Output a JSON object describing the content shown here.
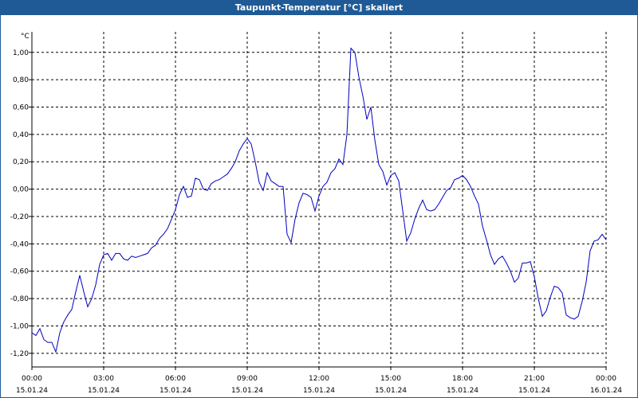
{
  "window": {
    "title": "Taupunkt-Temperatur [°C] skaliert"
  },
  "chart_data": {
    "type": "line",
    "title": "Taupunkt-Temperatur [°C] skaliert",
    "ylabel": "°C",
    "xlabel": "",
    "grid": true,
    "ylim": [
      -1.3,
      1.15
    ],
    "xlim": [
      0,
      24
    ],
    "y_ticks": [
      {
        "value": 1.0,
        "label": "1,00"
      },
      {
        "value": 0.8,
        "label": "0,80"
      },
      {
        "value": 0.6,
        "label": "0,60"
      },
      {
        "value": 0.4,
        "label": "0,40"
      },
      {
        "value": 0.2,
        "label": "0,20"
      },
      {
        "value": 0.0,
        "label": "0,00"
      },
      {
        "value": -0.2,
        "label": "-0,20"
      },
      {
        "value": -0.4,
        "label": "-0,40"
      },
      {
        "value": -0.6,
        "label": "-0,60"
      },
      {
        "value": -0.8,
        "label": "-0,80"
      },
      {
        "value": -1.0,
        "label": "-1,00"
      },
      {
        "value": -1.2,
        "label": "-1,20"
      }
    ],
    "x_ticks": [
      {
        "value": 0,
        "time": "00:00",
        "date": "15.01.24"
      },
      {
        "value": 3,
        "time": "03:00",
        "date": "15.01.24"
      },
      {
        "value": 6,
        "time": "06:00",
        "date": "15.01.24"
      },
      {
        "value": 9,
        "time": "09:00",
        "date": "15.01.24"
      },
      {
        "value": 12,
        "time": "12:00",
        "date": "15.01.24"
      },
      {
        "value": 15,
        "time": "15:00",
        "date": "15.01.24"
      },
      {
        "value": 18,
        "time": "18:00",
        "date": "15.01.24"
      },
      {
        "value": 21,
        "time": "21:00",
        "date": "15.01.24"
      },
      {
        "value": 24,
        "time": "00:00",
        "date": "16.01.24"
      }
    ],
    "series": [
      {
        "color": "#0000c0",
        "x": [
          0.0,
          0.167,
          0.333,
          0.5,
          0.667,
          0.833,
          1.0,
          1.167,
          1.333,
          1.5,
          1.667,
          1.833,
          2.0,
          2.167,
          2.333,
          2.5,
          2.667,
          2.833,
          3.0,
          3.167,
          3.333,
          3.5,
          3.667,
          3.833,
          4.0,
          4.167,
          4.333,
          4.5,
          4.667,
          4.833,
          5.0,
          5.167,
          5.333,
          5.5,
          5.667,
          5.833,
          6.0,
          6.167,
          6.333,
          6.5,
          6.667,
          6.833,
          7.0,
          7.167,
          7.333,
          7.5,
          7.667,
          7.833,
          8.0,
          8.167,
          8.333,
          8.5,
          8.667,
          8.833,
          9.0,
          9.167,
          9.333,
          9.5,
          9.667,
          9.833,
          10.0,
          10.167,
          10.333,
          10.5,
          10.667,
          10.833,
          11.0,
          11.167,
          11.333,
          11.5,
          11.667,
          11.833,
          12.0,
          12.167,
          12.333,
          12.5,
          12.667,
          12.833,
          13.0,
          13.167,
          13.333,
          13.5,
          13.667,
          13.833,
          14.0,
          14.167,
          14.333,
          14.5,
          14.667,
          14.833,
          15.0,
          15.167,
          15.333,
          15.5,
          15.667,
          15.833,
          16.0,
          16.167,
          16.333,
          16.5,
          16.667,
          16.833,
          17.0,
          17.167,
          17.333,
          17.5,
          17.667,
          17.833,
          18.0,
          18.167,
          18.333,
          18.5,
          18.667,
          18.833,
          19.0,
          19.167,
          19.333,
          19.5,
          19.667,
          19.833,
          20.0,
          20.167,
          20.333,
          20.5,
          20.667,
          20.833,
          21.0,
          21.167,
          21.333,
          21.5,
          21.667,
          21.833,
          22.0,
          22.167,
          22.333,
          22.5,
          22.667,
          22.833,
          23.0,
          23.167,
          23.333,
          23.5,
          23.667,
          23.833,
          24.0
        ],
        "y": [
          -1.05,
          -1.07,
          -1.02,
          -1.1,
          -1.12,
          -1.12,
          -1.19,
          -1.05,
          -0.97,
          -0.92,
          -0.88,
          -0.75,
          -0.63,
          -0.75,
          -0.86,
          -0.8,
          -0.7,
          -0.55,
          -0.48,
          -0.47,
          -0.52,
          -0.47,
          -0.47,
          -0.51,
          -0.52,
          -0.49,
          -0.5,
          -0.49,
          -0.48,
          -0.47,
          -0.43,
          -0.41,
          -0.36,
          -0.33,
          -0.29,
          -0.22,
          -0.15,
          -0.04,
          0.02,
          -0.06,
          -0.05,
          0.08,
          0.07,
          0.0,
          -0.01,
          0.04,
          0.06,
          0.07,
          0.09,
          0.11,
          0.15,
          0.2,
          0.28,
          0.33,
          0.37,
          0.33,
          0.2,
          0.05,
          -0.01,
          0.12,
          0.06,
          0.04,
          0.02,
          0.02,
          -0.33,
          -0.39,
          -0.22,
          -0.1,
          -0.03,
          -0.04,
          -0.06,
          -0.16,
          -0.05,
          0.02,
          0.05,
          0.12,
          0.15,
          0.22,
          0.18,
          0.4,
          1.03,
          1.0,
          0.82,
          0.68,
          0.51,
          0.6,
          0.36,
          0.18,
          0.13,
          0.03,
          0.1,
          0.12,
          0.06,
          -0.16,
          -0.38,
          -0.32,
          -0.22,
          -0.14,
          -0.08,
          -0.15,
          -0.16,
          -0.15,
          -0.11,
          -0.06,
          -0.01,
          0.01,
          0.07,
          0.08,
          0.1,
          0.07,
          0.02,
          -0.05,
          -0.11,
          -0.27,
          -0.37,
          -0.48,
          -0.55,
          -0.51,
          -0.49,
          -0.54,
          -0.6,
          -0.68,
          -0.65,
          -0.54,
          -0.54,
          -0.53,
          -0.64,
          -0.8,
          -0.93,
          -0.89,
          -0.79,
          -0.71,
          -0.72,
          -0.76,
          -0.92,
          -0.94,
          -0.95,
          -0.93,
          -0.82,
          -0.68,
          -0.45,
          -0.38,
          -0.37,
          -0.33,
          -0.37
        ]
      }
    ]
  }
}
